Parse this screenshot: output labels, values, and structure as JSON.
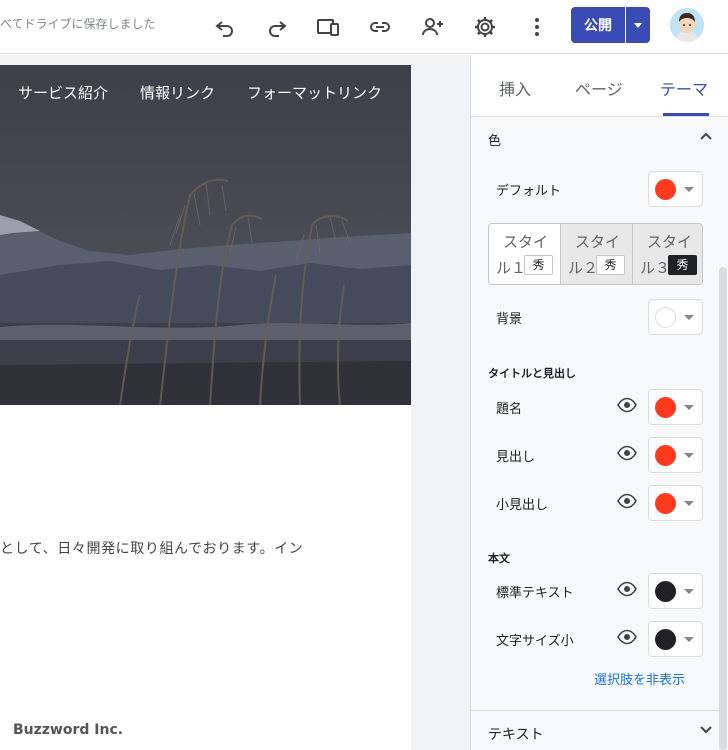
{
  "toolbar": {
    "save_status": "べてドライブに保存しました",
    "publish_label": "公開"
  },
  "site": {
    "nav": [
      "サービス紹介",
      "情報リンク",
      "フォーマットリンク"
    ],
    "body_text": "として、日々開発に取り組んでおります。イン",
    "footer": "Buzzword Inc."
  },
  "panel": {
    "tabs": [
      "挿入",
      "ページ",
      "テーマ"
    ],
    "active_tab": "テーマ",
    "color_section": "色",
    "default_label": "デフォルト",
    "styles": [
      {
        "line1": "スタイ",
        "line2": "ル１",
        "badge": "秀"
      },
      {
        "line1": "スタイ",
        "line2": "ル２",
        "badge": "秀"
      },
      {
        "line1": "スタイ",
        "line2": "ル３",
        "badge": "秀"
      }
    ],
    "background_label": "背景",
    "titles_heading": "タイトルと見出し",
    "title_label": "題名",
    "heading_label": "見出し",
    "subheading_label": "小見出し",
    "body_heading": "本文",
    "standard_text_label": "標準テキスト",
    "small_text_label": "文字サイズ小",
    "hide_options": "選択肢を非表示",
    "text_section": "テキスト"
  },
  "colors": {
    "accent": "#3b4bb5",
    "theme_red": "#ff3b1f",
    "text_dark": "#202124",
    "white": "#ffffff"
  }
}
